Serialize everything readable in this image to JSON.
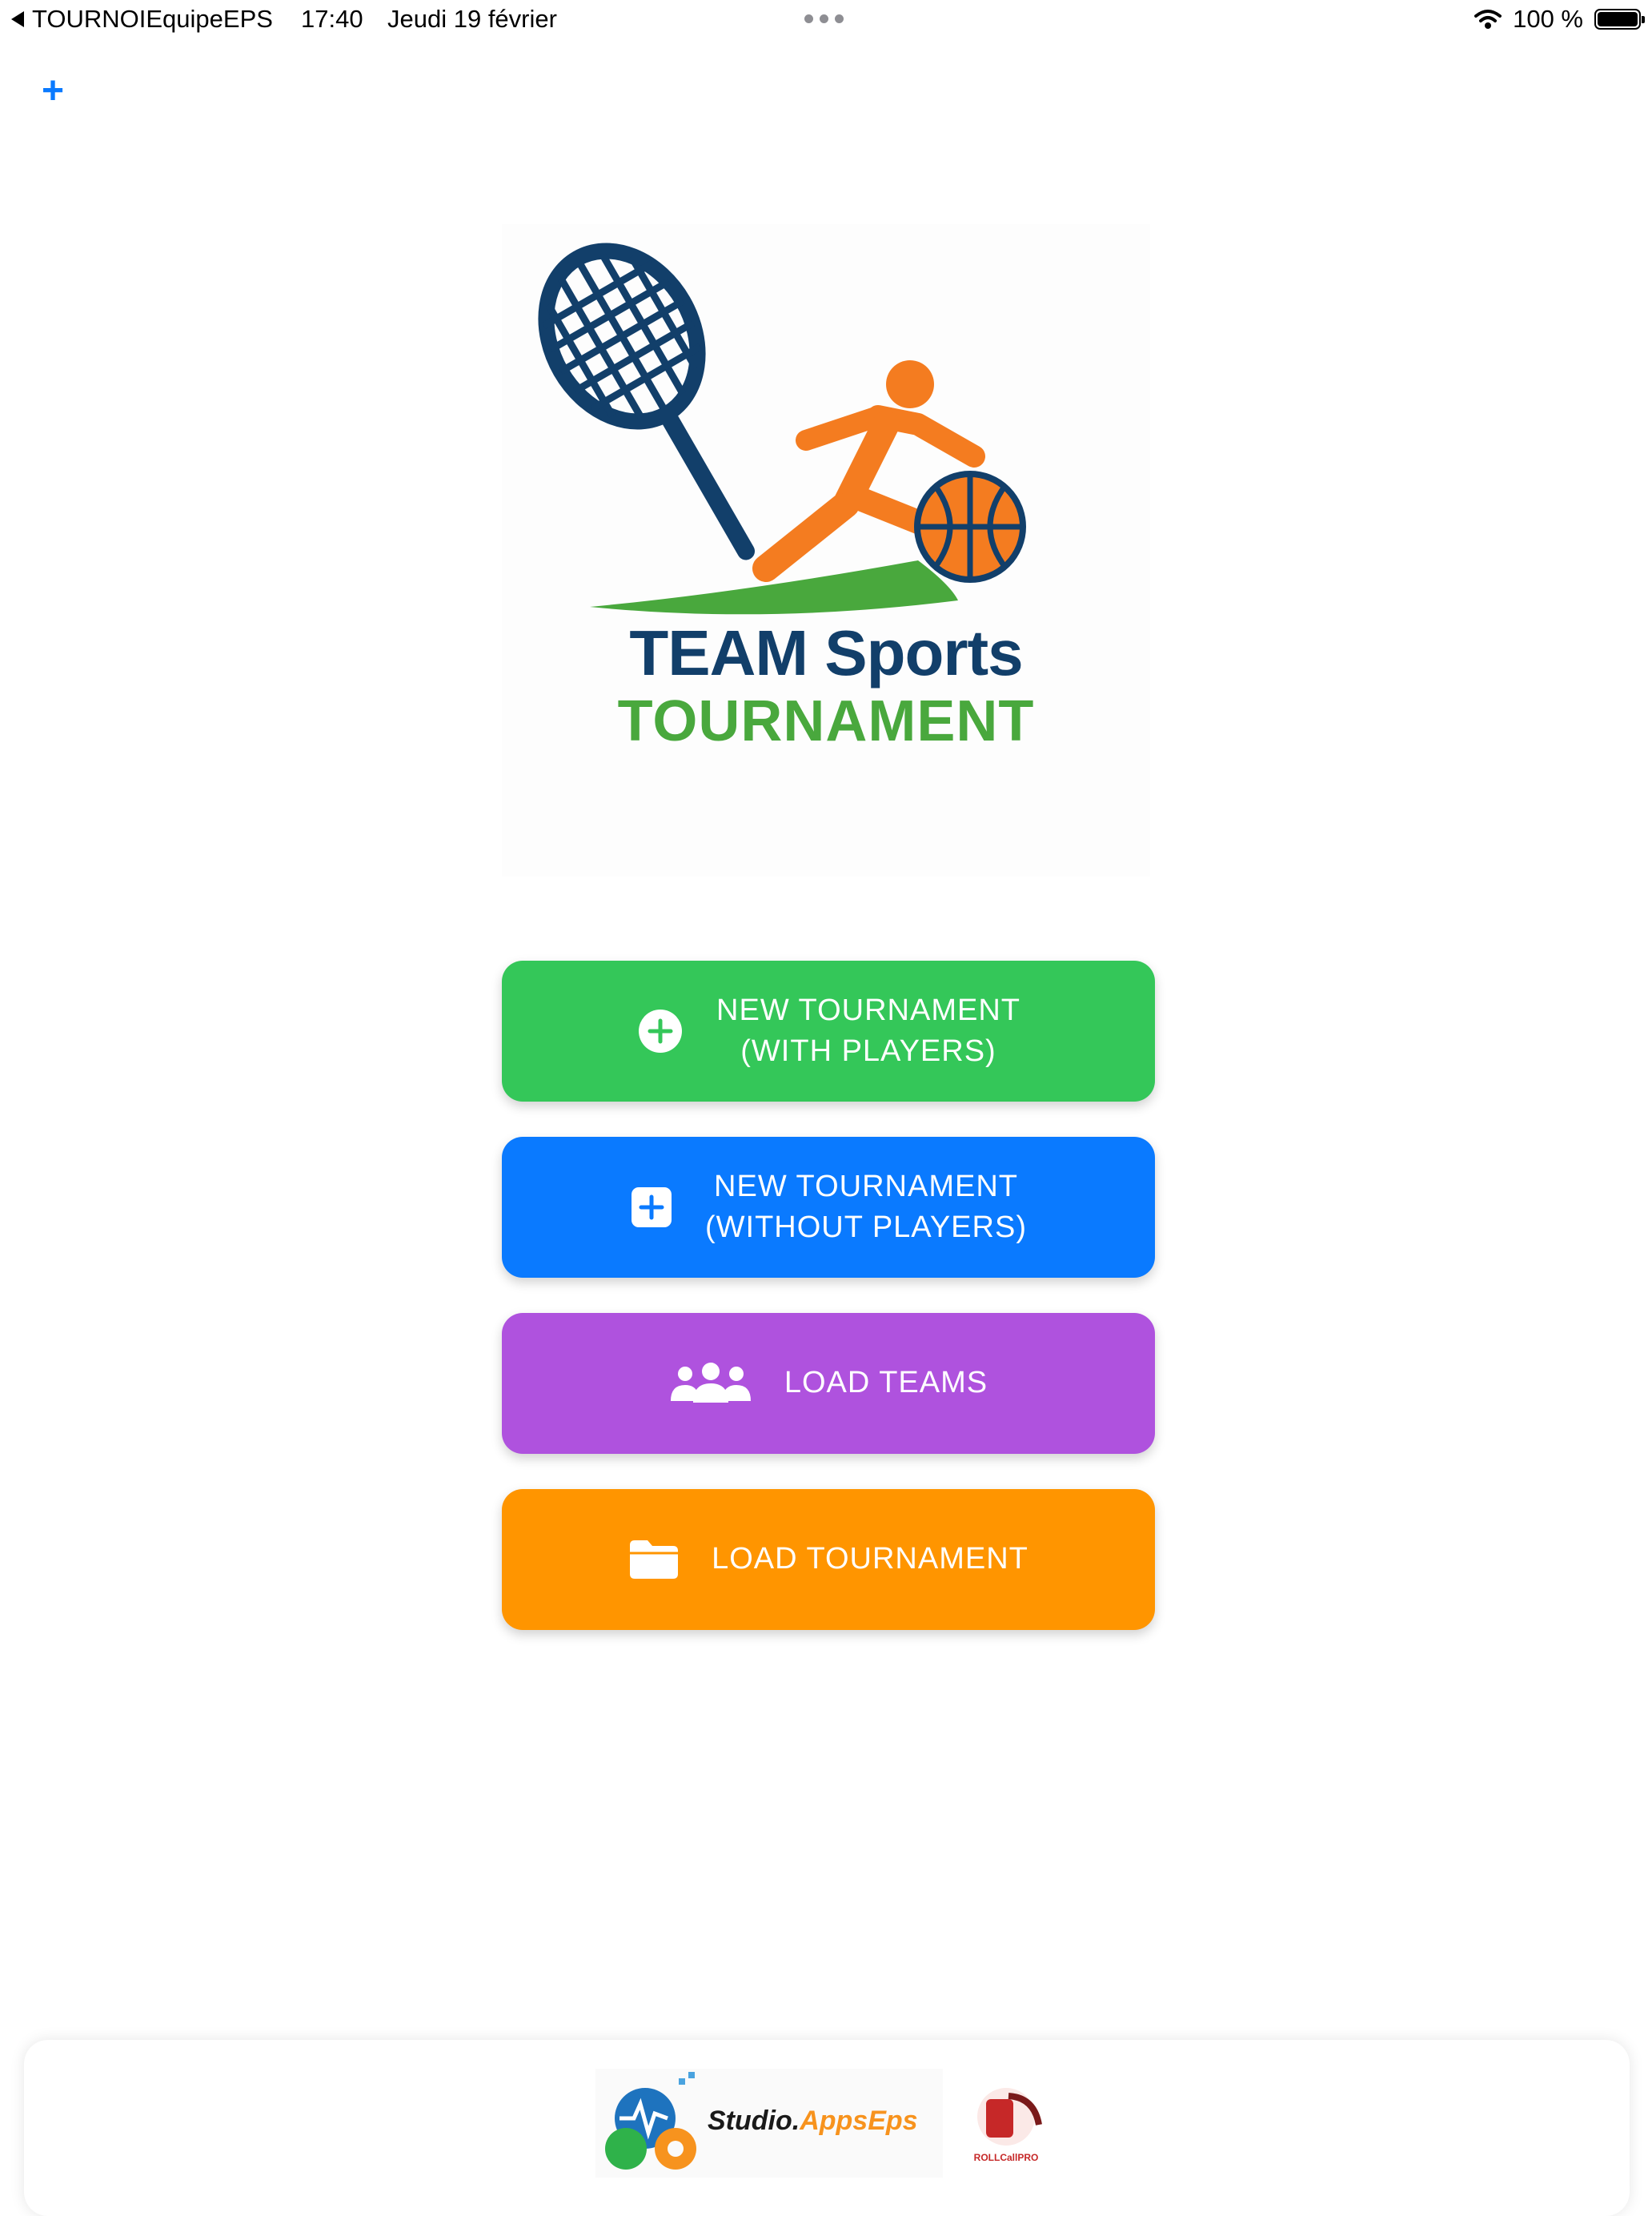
{
  "status_bar": {
    "back_app": "TOURNOIEquipeEPS",
    "time": "17:40",
    "date": "Jeudi 19 février",
    "battery": "100 %"
  },
  "toolbar": {
    "add_label": "+"
  },
  "logo": {
    "line1": "TEAM Sports",
    "line2": "TOURNAMENT"
  },
  "buttons": {
    "new_with_players": {
      "line1": "NEW TOURNAMENT",
      "line2": "(WITH PLAYERS)",
      "color": "#34c759"
    },
    "new_without_players": {
      "line1": "NEW TOURNAMENT",
      "line2": "(WITHOUT PLAYERS)",
      "color": "#0a7aff"
    },
    "load_teams": {
      "label": "LOAD TEAMS",
      "color": "#af52de"
    },
    "load_tournament": {
      "label": "LOAD TOURNAMENT",
      "color": "#ff9500"
    }
  },
  "footer": {
    "studio_part1": "Studio.",
    "studio_part2": "AppsEps",
    "rollcall": "ROLLCallPRO"
  }
}
